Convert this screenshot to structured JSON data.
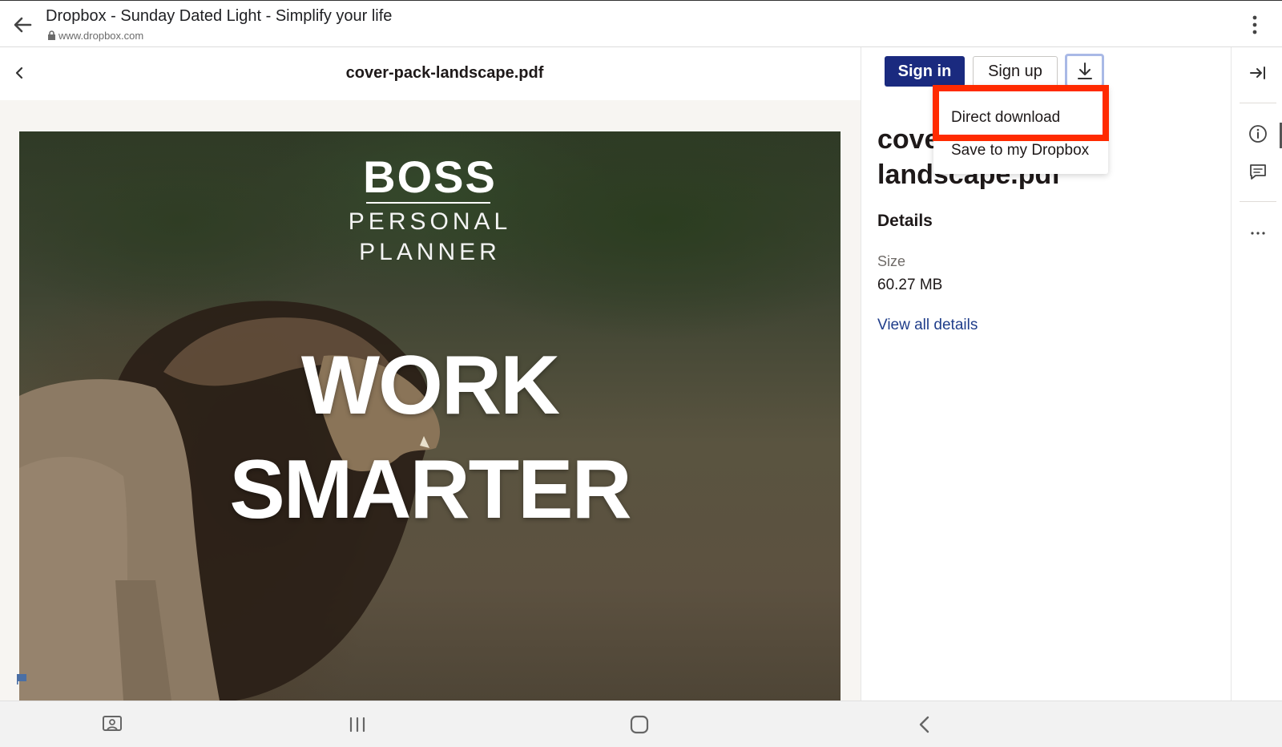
{
  "browser": {
    "title": "Dropbox - Sunday Dated Light - Simplify your life",
    "url": "www.dropbox.com",
    "icons": [
      "back-arrow-icon",
      "lock-icon",
      "more-vertical-icon"
    ]
  },
  "viewer": {
    "file_name": "cover-pack-landscape.pdf",
    "preview": {
      "brand": "BOSS",
      "subtitle_line1": "PERSONAL",
      "subtitle_line2": "PLANNER",
      "headline_line1": "WORK",
      "headline_line2": "SMARTER"
    }
  },
  "sidebar": {
    "sign_in_label": "Sign in",
    "sign_up_label": "Sign up",
    "file_name_line1": "cover-pack-",
    "file_name_line2": "landscape.pdf",
    "details_heading": "Details",
    "size_label": "Size",
    "size_value": "60.27 MB",
    "view_all_label": "View all details",
    "accent_color": "#1a2a7f"
  },
  "download_menu": {
    "items": [
      "Direct download",
      "Save to my Dropbox"
    ],
    "highlight_color": "#ff2a00"
  },
  "rail": {
    "icons": [
      "collapse-panel-icon",
      "info-icon",
      "comment-icon",
      "more-horizontal-icon"
    ]
  },
  "navbar": {
    "icons": [
      "screen-icon",
      "recent-apps-icon",
      "home-icon",
      "back-icon"
    ]
  }
}
